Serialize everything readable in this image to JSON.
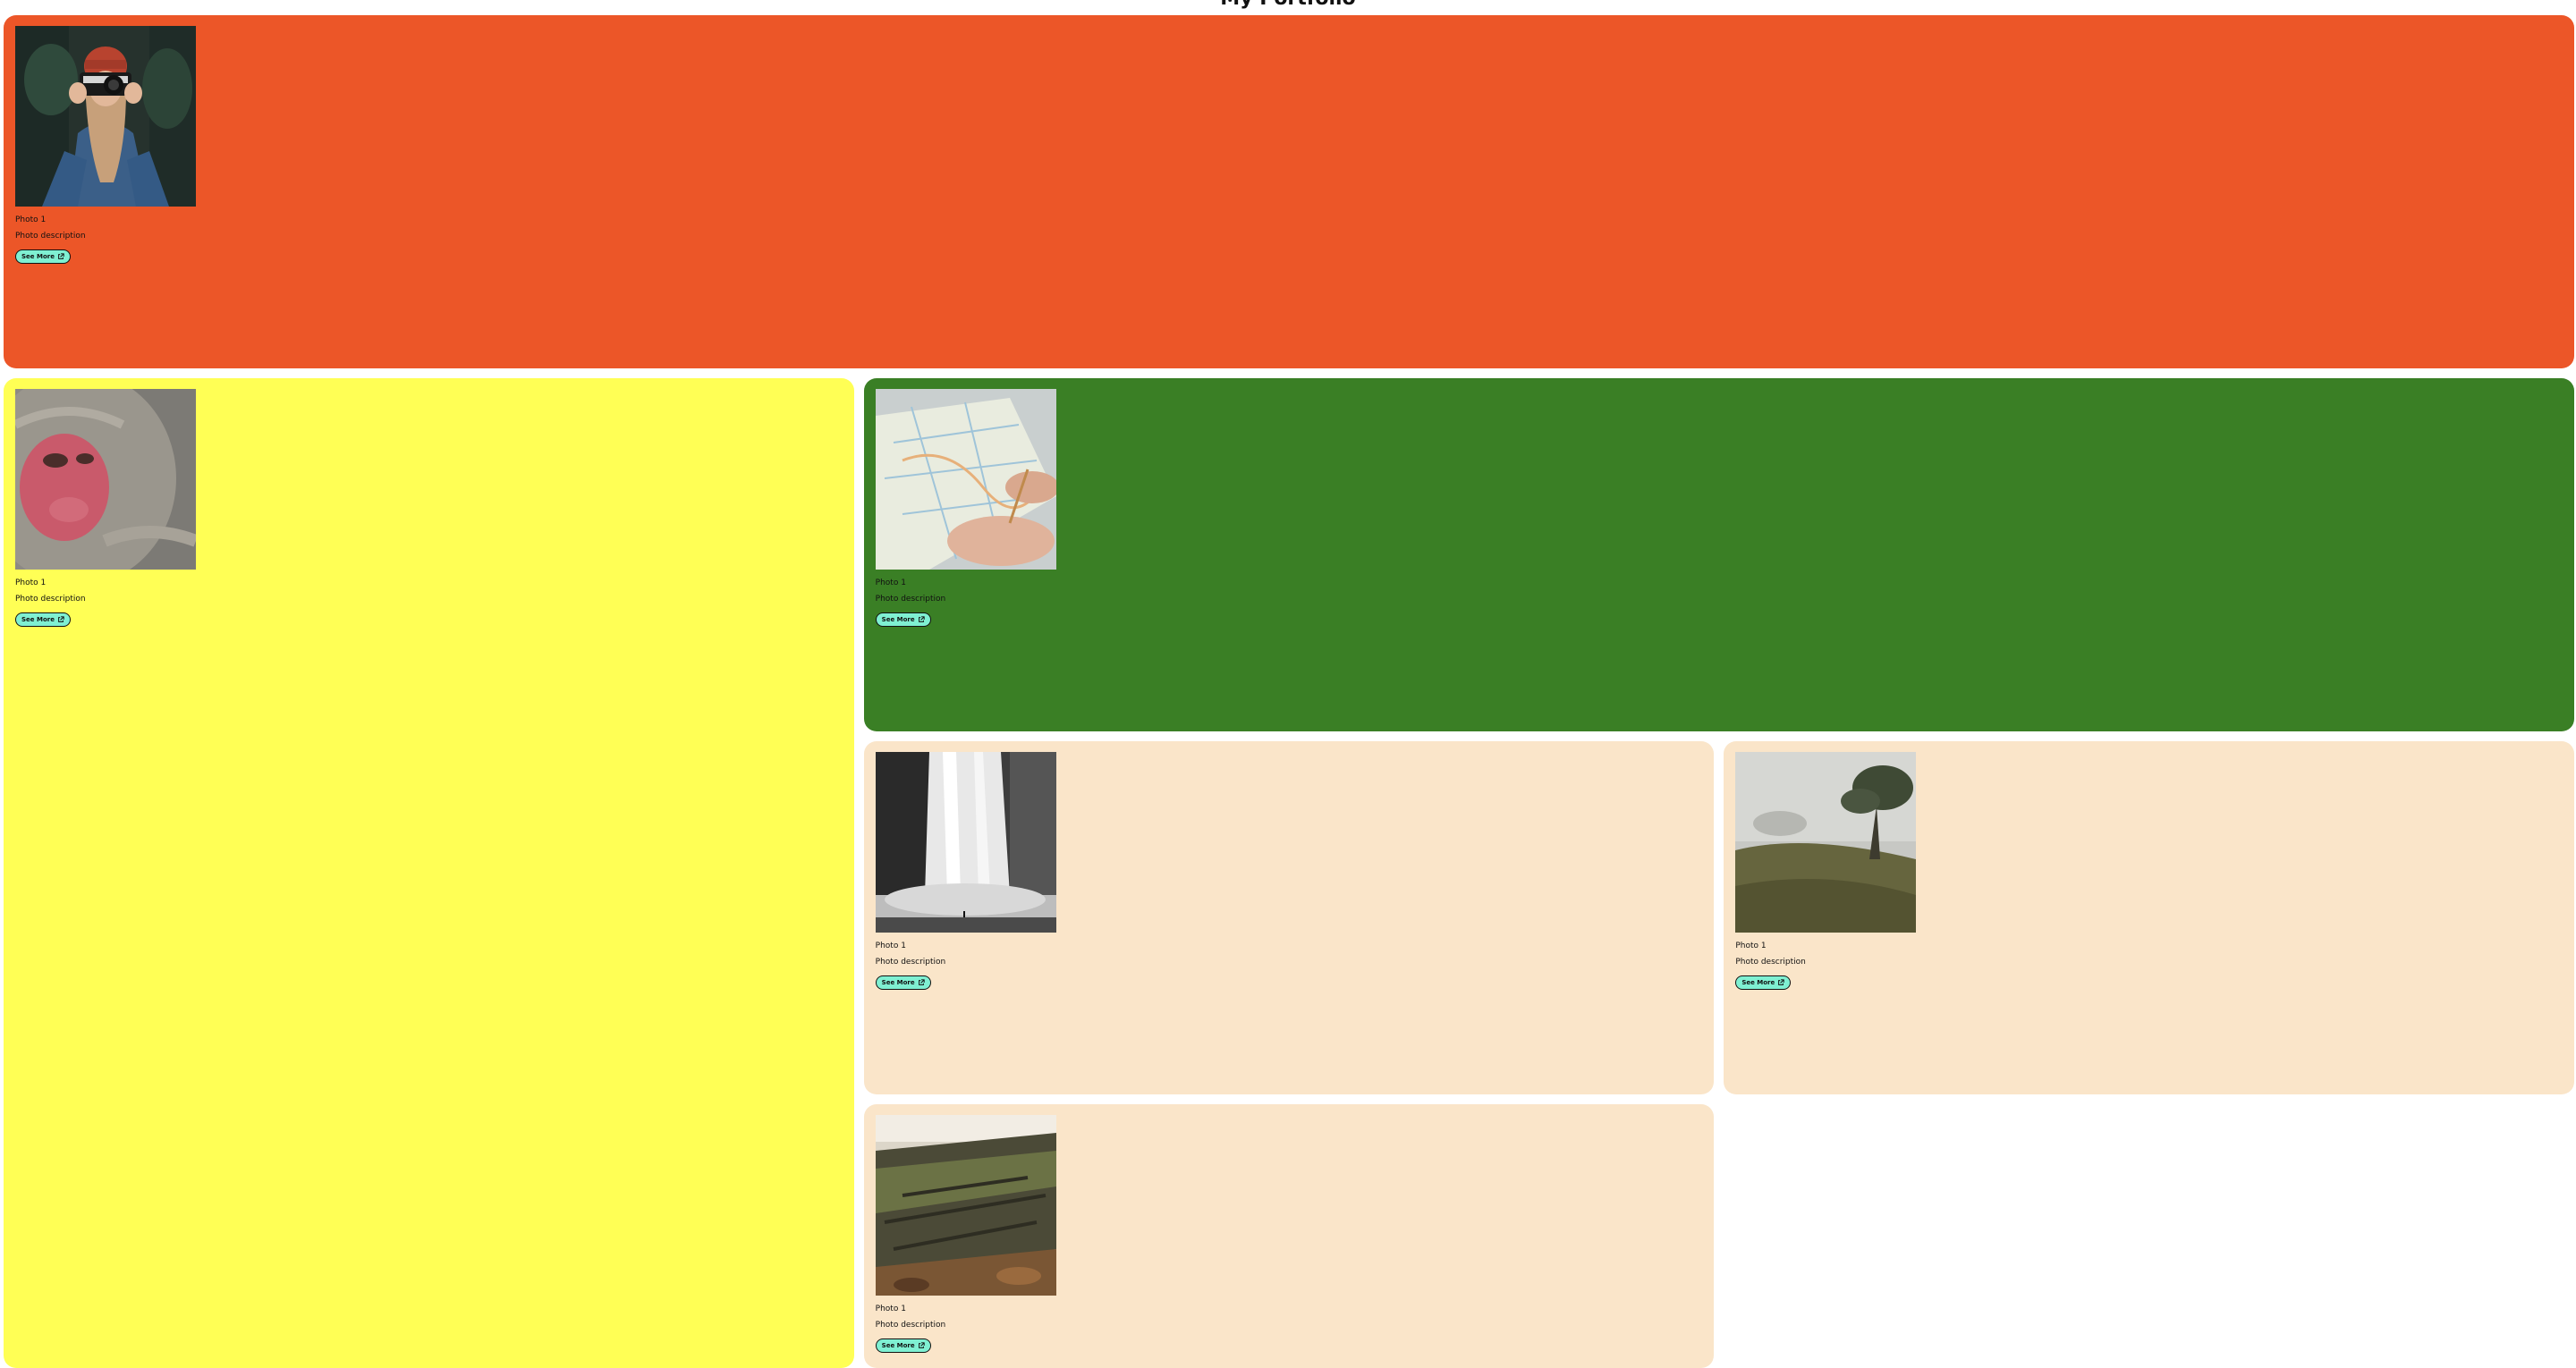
{
  "page": {
    "title": "My Portfolio"
  },
  "colors": {
    "card_1": "#ec5628",
    "card_2": "#ffff55",
    "card_3": "#3a7f25",
    "card_4": "#fae5c9",
    "card_5": "#fae5c9",
    "card_6": "#fae5c9",
    "button_bg": "#7ff0d2"
  },
  "cards": [
    {
      "photo_icon": "photographer-photo",
      "caption": "Photo 1",
      "description": "Photo description",
      "button_label": "See More",
      "button_icon": "external-link-icon"
    },
    {
      "photo_icon": "monkey-photo",
      "caption": "Photo 1",
      "description": "Photo description",
      "button_label": "See More",
      "button_icon": "external-link-icon"
    },
    {
      "photo_icon": "map-photo",
      "caption": "Photo 1",
      "description": "Photo description",
      "button_label": "See More",
      "button_icon": "external-link-icon"
    },
    {
      "photo_icon": "waterfall-photo",
      "caption": "Photo 1",
      "description": "Photo description",
      "button_label": "See More",
      "button_icon": "external-link-icon"
    },
    {
      "photo_icon": "foggy-hill-photo",
      "caption": "Photo 1",
      "description": "Photo description",
      "button_label": "See More",
      "button_icon": "external-link-icon"
    },
    {
      "photo_icon": "mossy-log-photo",
      "caption": "Photo 1",
      "description": "Photo description",
      "button_label": "See More",
      "button_icon": "external-link-icon"
    }
  ]
}
